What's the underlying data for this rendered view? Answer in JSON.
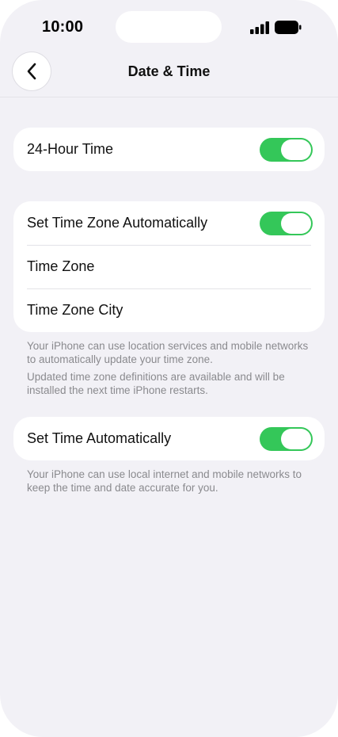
{
  "status_bar": {
    "time": "10:00"
  },
  "nav": {
    "title": "Date & Time",
    "back_icon": "chevron-left-icon"
  },
  "sections": {
    "hour_format": {
      "label": "24-Hour Time",
      "toggle_on": true
    },
    "time_zone": {
      "auto_label": "Set Time Zone Automatically",
      "auto_on": true,
      "zone_label": "Time Zone",
      "city_label": "Time Zone City",
      "footnote_1": "Your iPhone can use location services and mobile networks to automatically update your time zone.",
      "footnote_2": "Updated time zone definitions are available and will be installed the next time iPhone restarts."
    },
    "time_auto": {
      "label": "Set Time Automatically",
      "toggle_on": true,
      "footnote": "Your iPhone can use local internet and mobile networks to keep the time and date accurate for you."
    }
  },
  "colors": {
    "background": "#f2f1f6",
    "card": "#ffffff",
    "toggle_on": "#34c759",
    "footnote_text": "#8a8a8e"
  }
}
